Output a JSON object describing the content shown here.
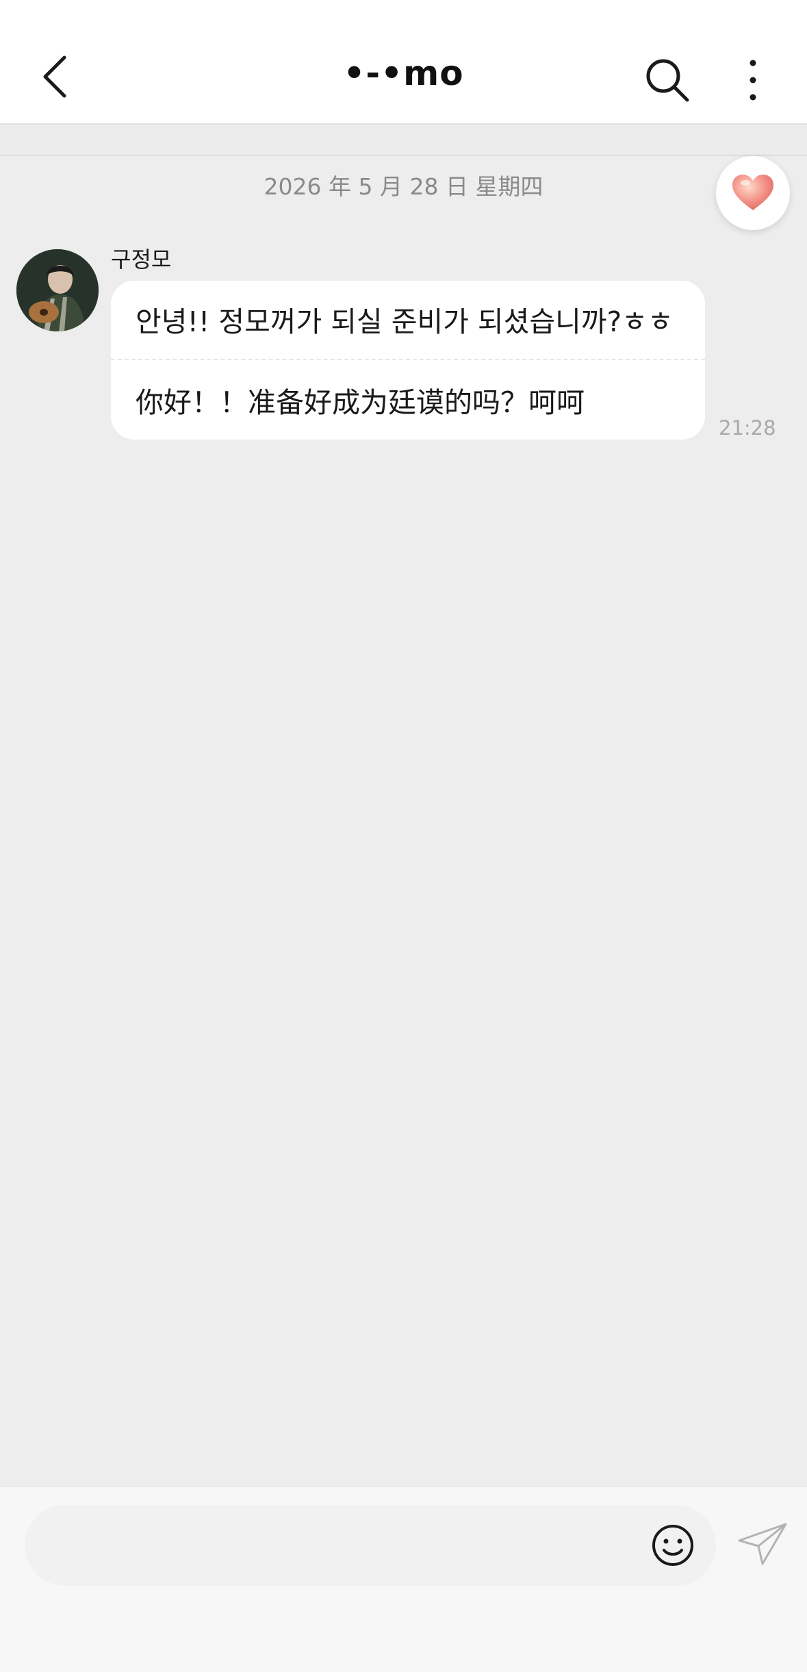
{
  "header": {
    "title": "•-•mo",
    "back_icon": "chevron-left-icon",
    "search_icon": "search-icon",
    "more_icon": "more-vertical-icon"
  },
  "chat": {
    "date_separator": "2026 年 5 月 28 日  星期四",
    "floating_icon": "heart-icon",
    "messages": [
      {
        "sender": "구정모",
        "avatar": "avatar-photo",
        "text_original": "안녕!! 정모꺼가 되실 준비가 되셨습니까?ㅎㅎ",
        "text_translation": "你好！！准备好成为廷谟的吗？呵呵",
        "time": "21:28"
      }
    ]
  },
  "composer": {
    "input_value": "",
    "emoji_icon": "emoji-icon",
    "send_icon": "send-paper-plane-icon"
  },
  "colors": {
    "background": "#ededed",
    "header_bg": "#ffffff",
    "bubble_bg": "#ffffff",
    "time_text": "#a9a9a9",
    "heart_accent": "#f08a80"
  }
}
